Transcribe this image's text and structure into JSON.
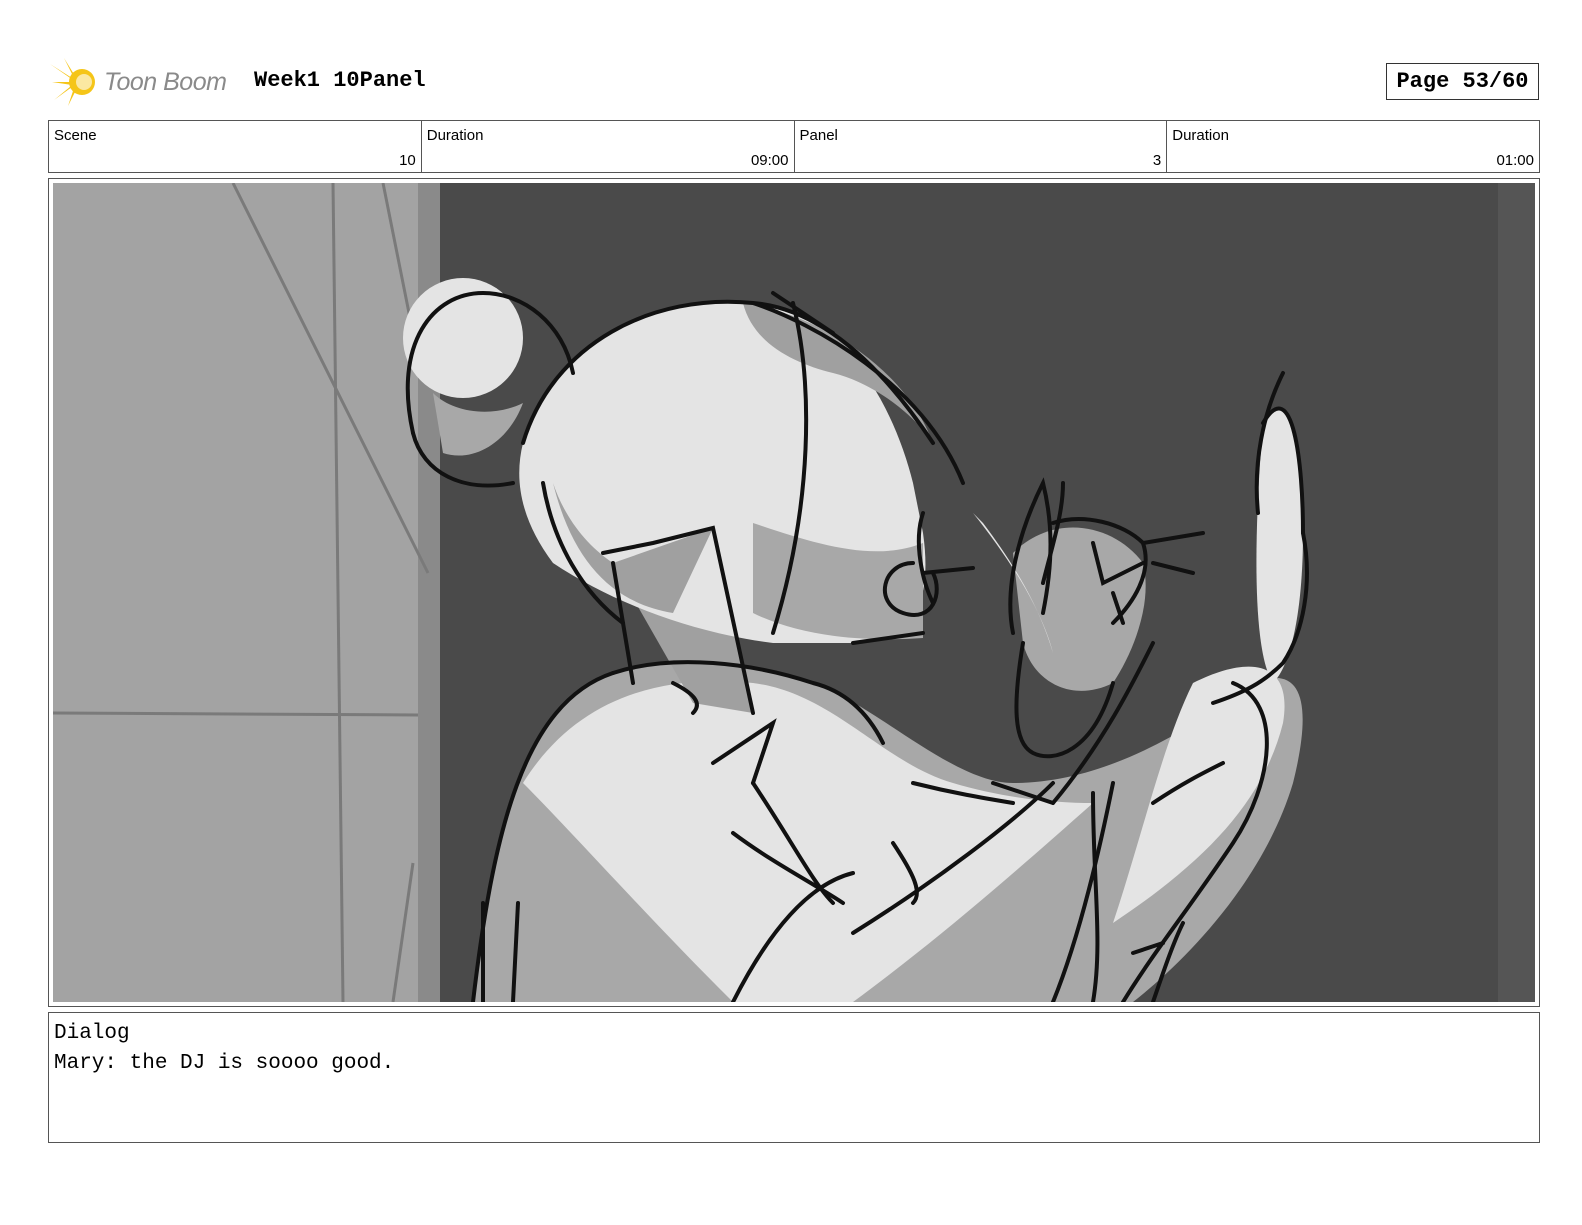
{
  "header": {
    "logo_text": "Toon Boom",
    "title": "Week1 10Panel",
    "page_label": "Page 53/60"
  },
  "info": {
    "scene_label": "Scene",
    "scene_value": "10",
    "scene_duration_label": "Duration",
    "scene_duration_value": "09:00",
    "panel_label": "Panel",
    "panel_value": "3",
    "panel_duration_label": "Duration",
    "panel_duration_value": "01:00"
  },
  "panel_image": {
    "description_icon": "storyboard-sketch"
  },
  "dialog": {
    "heading": "Dialog",
    "line": "Mary: the DJ is soooo good."
  },
  "colors": {
    "logo_yellow": "#f5c518",
    "background_dark": "#4a4a4a",
    "wall_gray": "#a3a3a3",
    "skin_light": "#e6e6e6"
  }
}
